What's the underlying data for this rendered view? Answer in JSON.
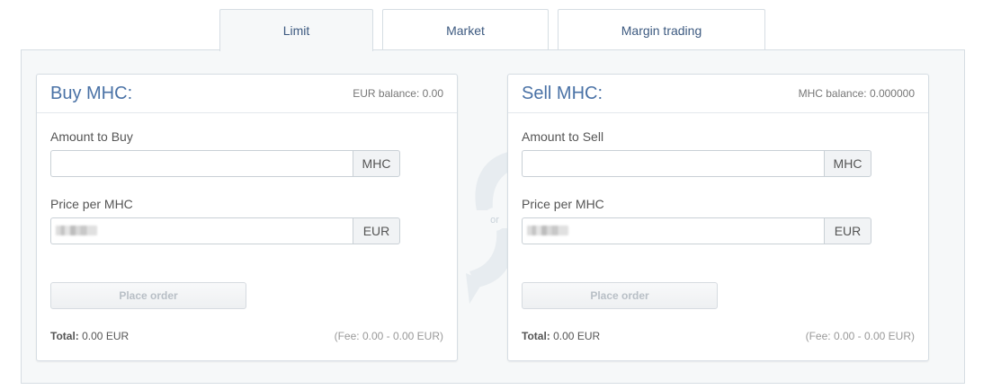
{
  "tabs": [
    {
      "label": "Limit",
      "active": true
    },
    {
      "label": "Market",
      "active": false
    },
    {
      "label": "Margin trading",
      "active": false
    }
  ],
  "divider": {
    "label": "or"
  },
  "buy": {
    "title": "Buy MHC:",
    "balance": "EUR balance: 0.00",
    "amount_label": "Amount to Buy",
    "amount_value": "",
    "amount_unit": "MHC",
    "price_label": "Price per MHC",
    "price_unit": "EUR",
    "button": "Place order",
    "total_label": "Total:",
    "total_value": "0.00 EUR",
    "fee": "(Fee: 0.00 - 0.00 EUR)"
  },
  "sell": {
    "title": "Sell MHC:",
    "balance": "MHC balance: 0.000000",
    "amount_label": "Amount to Sell",
    "amount_value": "",
    "amount_unit": "MHC",
    "price_label": "Price per MHC",
    "price_unit": "EUR",
    "button": "Place order",
    "total_label": "Total:",
    "total_value": "0.00 EUR",
    "fee": "(Fee: 0.00 - 0.00 EUR)"
  },
  "colors": {
    "accent": "#4a72a6",
    "panel_bg": "#f6f8f9",
    "border": "#d6dde3",
    "swap_graphic": "#e7ecf0"
  },
  "icons": {
    "swap": "swap-arrows-icon"
  }
}
